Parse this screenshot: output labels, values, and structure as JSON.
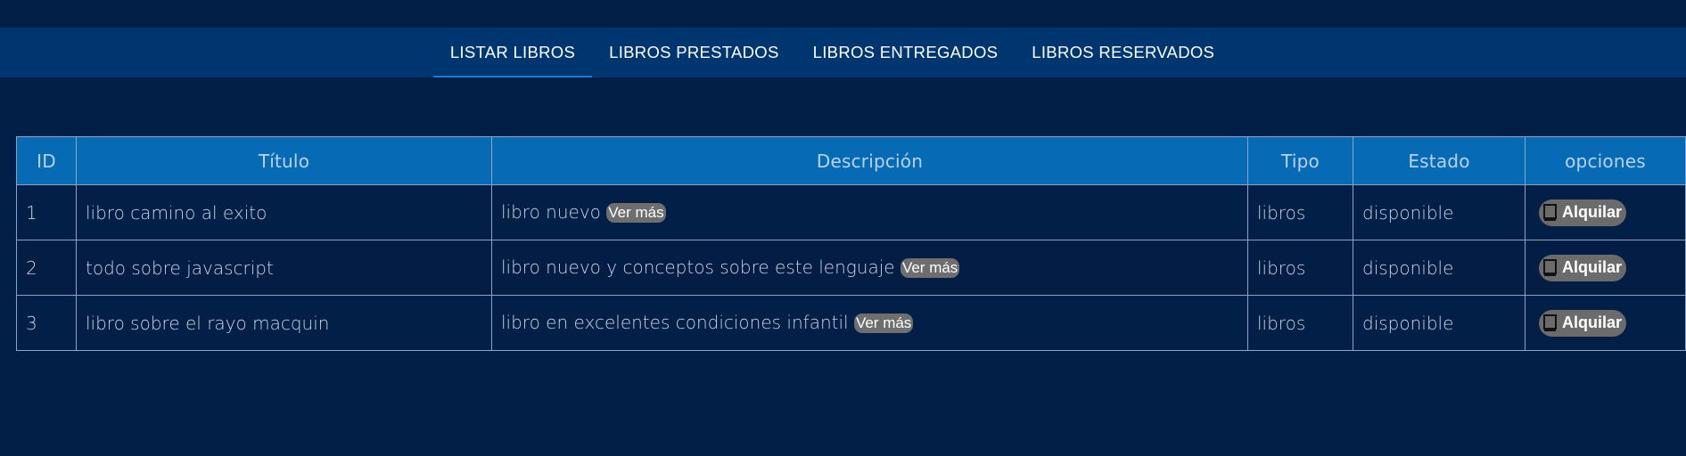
{
  "nav": {
    "tabs": [
      {
        "label": "LISTAR LIBROS",
        "active": true
      },
      {
        "label": "LIBROS PRESTADOS",
        "active": false
      },
      {
        "label": "LIBROS ENTREGADOS",
        "active": false
      },
      {
        "label": "LIBROS RESERVADOS",
        "active": false
      }
    ]
  },
  "table": {
    "headers": [
      "ID",
      "Título",
      "Descripción",
      "Tipo",
      "Estado",
      "opciones"
    ],
    "rows": [
      {
        "id": "1",
        "titulo": "libro camino al exito",
        "descripcion": "libro nuevo",
        "ver_mas": "Ver más",
        "tipo": "libros",
        "estado": "disponible",
        "action_label": "Alquilar",
        "action_icon": "book-icon"
      },
      {
        "id": "2",
        "titulo": "todo sobre javascript",
        "descripcion": "libro nuevo y conceptos sobre este lenguaje",
        "ver_mas": "Ver más",
        "tipo": "libros",
        "estado": "disponible",
        "action_label": "Alquilar",
        "action_icon": "book-icon"
      },
      {
        "id": "3",
        "titulo": "libro sobre el rayo macquin",
        "descripcion": "libro en excelentes condiciones infantil",
        "ver_mas": "Ver más",
        "tipo": "libros",
        "estado": "disponible",
        "action_label": "Alquilar",
        "action_icon": "book-icon"
      }
    ]
  },
  "colors": {
    "background": "#021f47",
    "navbar": "#003670",
    "header": "#066bb4",
    "button": "#6b6b6b",
    "active_underline": "#1e7ad6"
  }
}
